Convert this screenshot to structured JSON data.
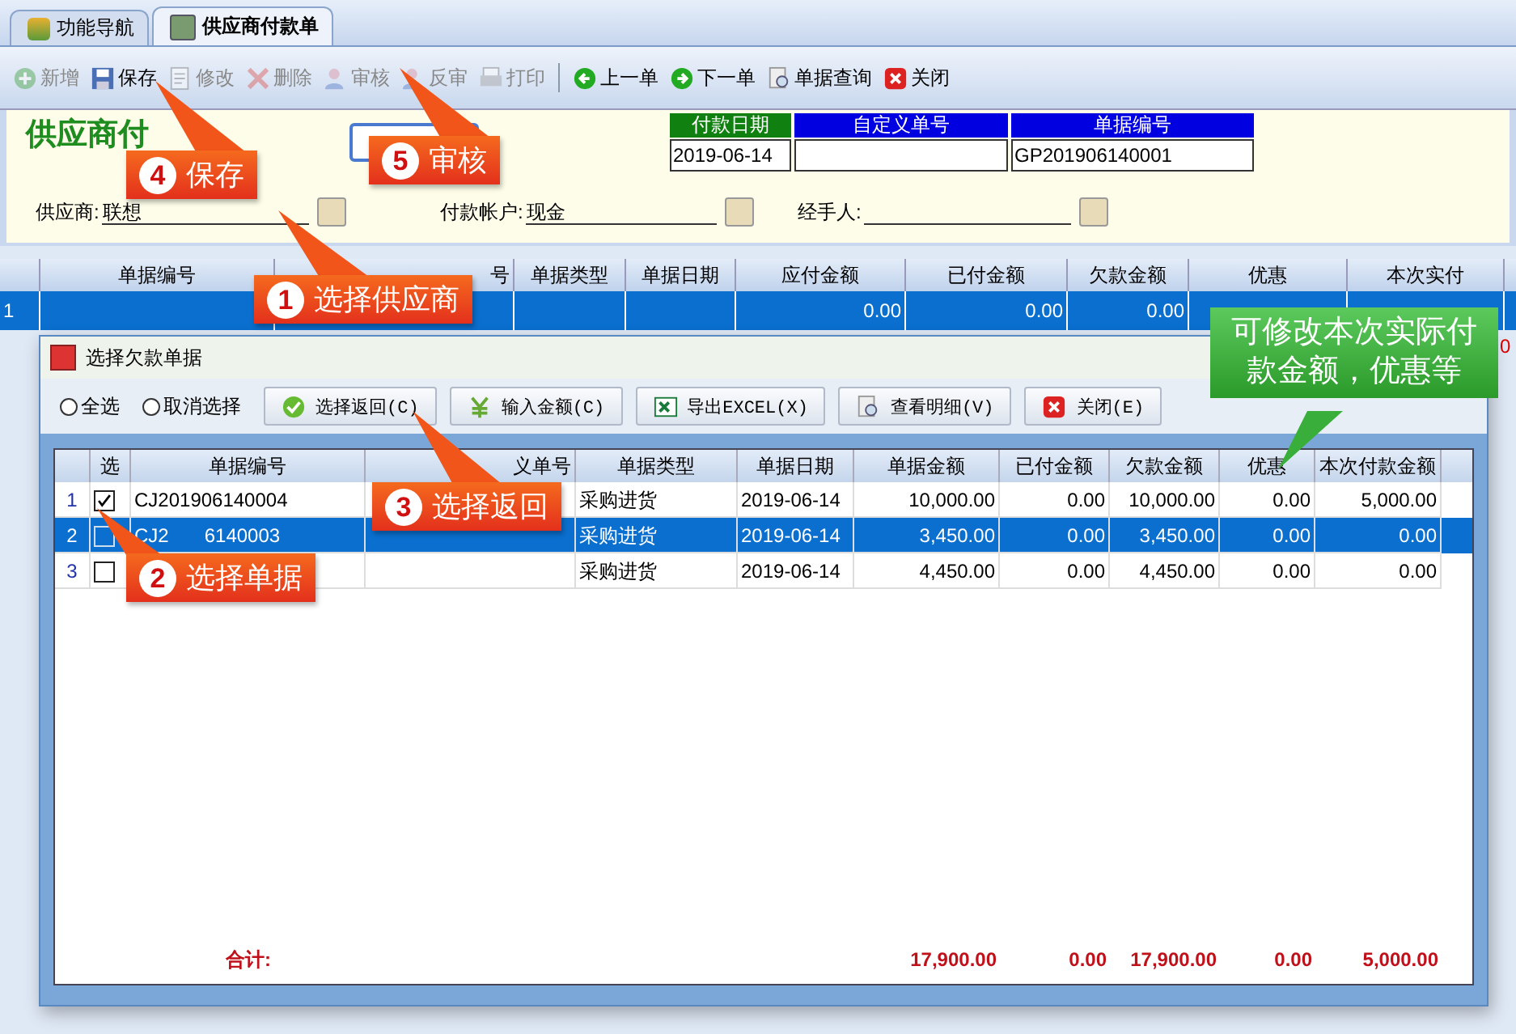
{
  "tabs": [
    {
      "label": "功能导航",
      "selected": false
    },
    {
      "label": "供应商付款单",
      "selected": true
    }
  ],
  "toolbar": [
    {
      "label": "新增",
      "disabled": true
    },
    {
      "label": "保存",
      "disabled": false
    },
    {
      "label": "修改",
      "disabled": true
    },
    {
      "label": "删除",
      "disabled": true
    },
    {
      "label": "审核",
      "disabled": true
    },
    {
      "label": "反审",
      "disabled": true
    },
    {
      "label": "打印",
      "disabled": true,
      "separator_after": true
    },
    {
      "label": "上一单",
      "disabled": false
    },
    {
      "label": "下一单",
      "disabled": false
    },
    {
      "label": "单据查询",
      "disabled": false
    },
    {
      "label": "关闭",
      "disabled": false
    }
  ],
  "form": {
    "title": "供应商付",
    "header_fields": [
      {
        "label": "付款日期",
        "value": "2019-06-14",
        "color": "#108010"
      },
      {
        "label": "自定义单号",
        "color": "#0000e0"
      },
      {
        "label": "单据编号",
        "value": "GP201906140001",
        "color": "#0000e0"
      }
    ],
    "fields": [
      {
        "label": "供应商:",
        "value": "联想"
      },
      {
        "label": "付款帐户:",
        "value": "现金"
      },
      {
        "label": "经手人:"
      }
    ]
  },
  "main_grid": {
    "columns": [
      null,
      "单据编号",
      "号",
      "单据类型",
      "单据日期",
      "应付金额",
      "已付金额",
      "欠款金额",
      "优惠",
      "本次实付"
    ],
    "rows": [
      {
        "selected": true,
        "cells": [
          "1",
          null,
          null,
          null,
          null,
          "0.00",
          "0.00",
          "0.00",
          null,
          null
        ]
      }
    ],
    "side_mark": "0"
  },
  "dialog": {
    "title": "选择欠款单据",
    "radios": [
      {
        "label": "全选",
        "selected": false
      },
      {
        "label": "取消选择",
        "selected": false
      }
    ],
    "buttons": [
      {
        "label": "选择返回(C)"
      },
      {
        "label": "输入金额(C)"
      },
      {
        "label": "导出EXCEL(X)"
      },
      {
        "label": "查看明细(V)"
      },
      {
        "label": "关闭(E)"
      }
    ],
    "columns": [
      null,
      "选",
      "单据编号",
      "义单号",
      "单据类型",
      "单据日期",
      "单据金额",
      "已付金额",
      "欠款金额",
      "优惠",
      "本次付款金额"
    ],
    "rows": [
      {
        "selected": false,
        "checked": true,
        "cells": [
          "1",
          null,
          "CJ201906140004",
          null,
          "采购进货",
          "2019-06-14",
          "10,000.00",
          "0.00",
          "10,000.00",
          "0.00",
          "5,000.00"
        ]
      },
      {
        "selected": true,
        "checked": false,
        "code_parts": [
          "CJ2",
          "6140003"
        ],
        "cells": [
          "2",
          null,
          null,
          null,
          "采购进货",
          "2019-06-14",
          "3,450.00",
          "0.00",
          "3,450.00",
          "0.00",
          "0.00"
        ]
      },
      {
        "selected": false,
        "checked": false,
        "cells": [
          "3",
          null,
          null,
          null,
          "采购进货",
          "2019-06-14",
          "4,450.00",
          "0.00",
          "4,450.00",
          "0.00",
          "0.00"
        ]
      }
    ],
    "totals": {
      "label": "合计:",
      "values": [
        "17,900.00",
        "0.00",
        "17,900.00",
        "0.00",
        "5,000.00"
      ]
    }
  },
  "callouts": [
    {
      "number": "4",
      "label": "保存",
      "kind": "red"
    },
    {
      "number": "5",
      "label": "审核",
      "kind": "red"
    },
    {
      "number": "1",
      "label": "选择供应商",
      "kind": "red"
    },
    {
      "number": "3",
      "label": "选择返回",
      "kind": "red"
    },
    {
      "number": "2",
      "label": "选择单据",
      "kind": "red"
    },
    {
      "label": "可修改本次实际付款金额，优惠等",
      "kind": "green"
    }
  ]
}
